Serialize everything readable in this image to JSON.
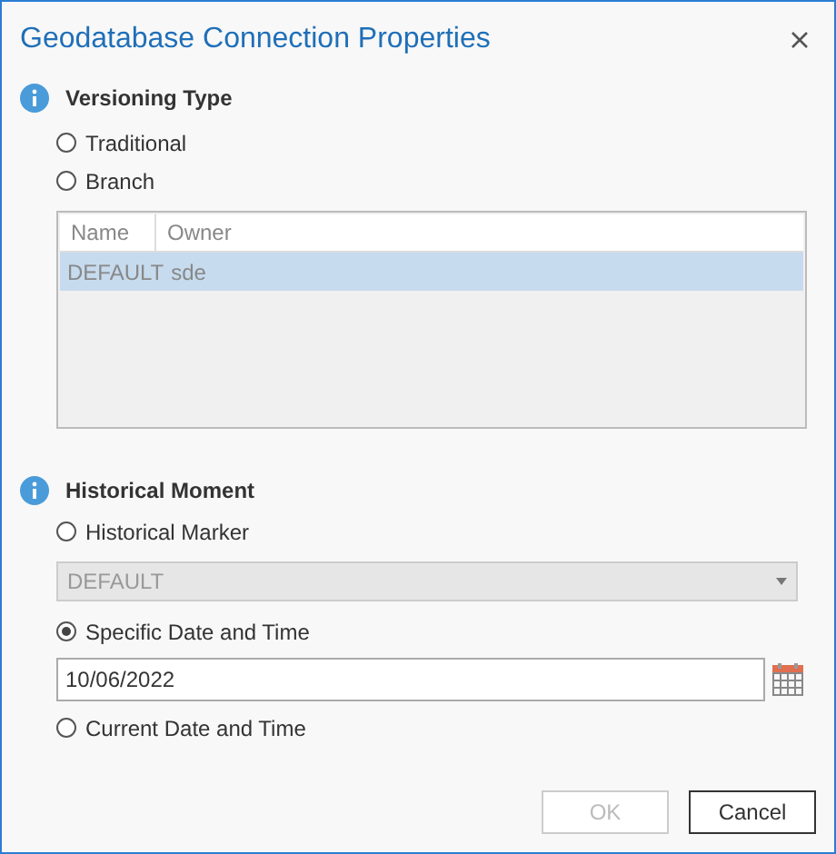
{
  "window": {
    "title": "Geodatabase Connection Properties"
  },
  "versioning_type": {
    "title": "Versioning Type",
    "options": [
      {
        "label": "Traditional",
        "selected": false
      },
      {
        "label": "Branch",
        "selected": false
      }
    ],
    "table": {
      "columns": [
        "Name",
        "Owner"
      ],
      "rows": [
        {
          "cells": [
            "DEFAULT",
            "sde"
          ],
          "selected": true
        }
      ]
    }
  },
  "historical_moment": {
    "title": "Historical Moment",
    "items": [
      {
        "kind": "radio",
        "label": "Historical Marker",
        "selected": false
      },
      {
        "kind": "dropdown",
        "value": "DEFAULT",
        "disabled": true
      },
      {
        "kind": "radio",
        "label": "Specific Date and Time",
        "selected": true
      },
      {
        "kind": "date",
        "value": "10/06/2022"
      },
      {
        "kind": "radio",
        "label": "Current Date and Time",
        "selected": false
      }
    ]
  },
  "buttons": [
    {
      "label": "OK",
      "disabled": true
    },
    {
      "label": "Cancel",
      "disabled": false
    }
  ]
}
